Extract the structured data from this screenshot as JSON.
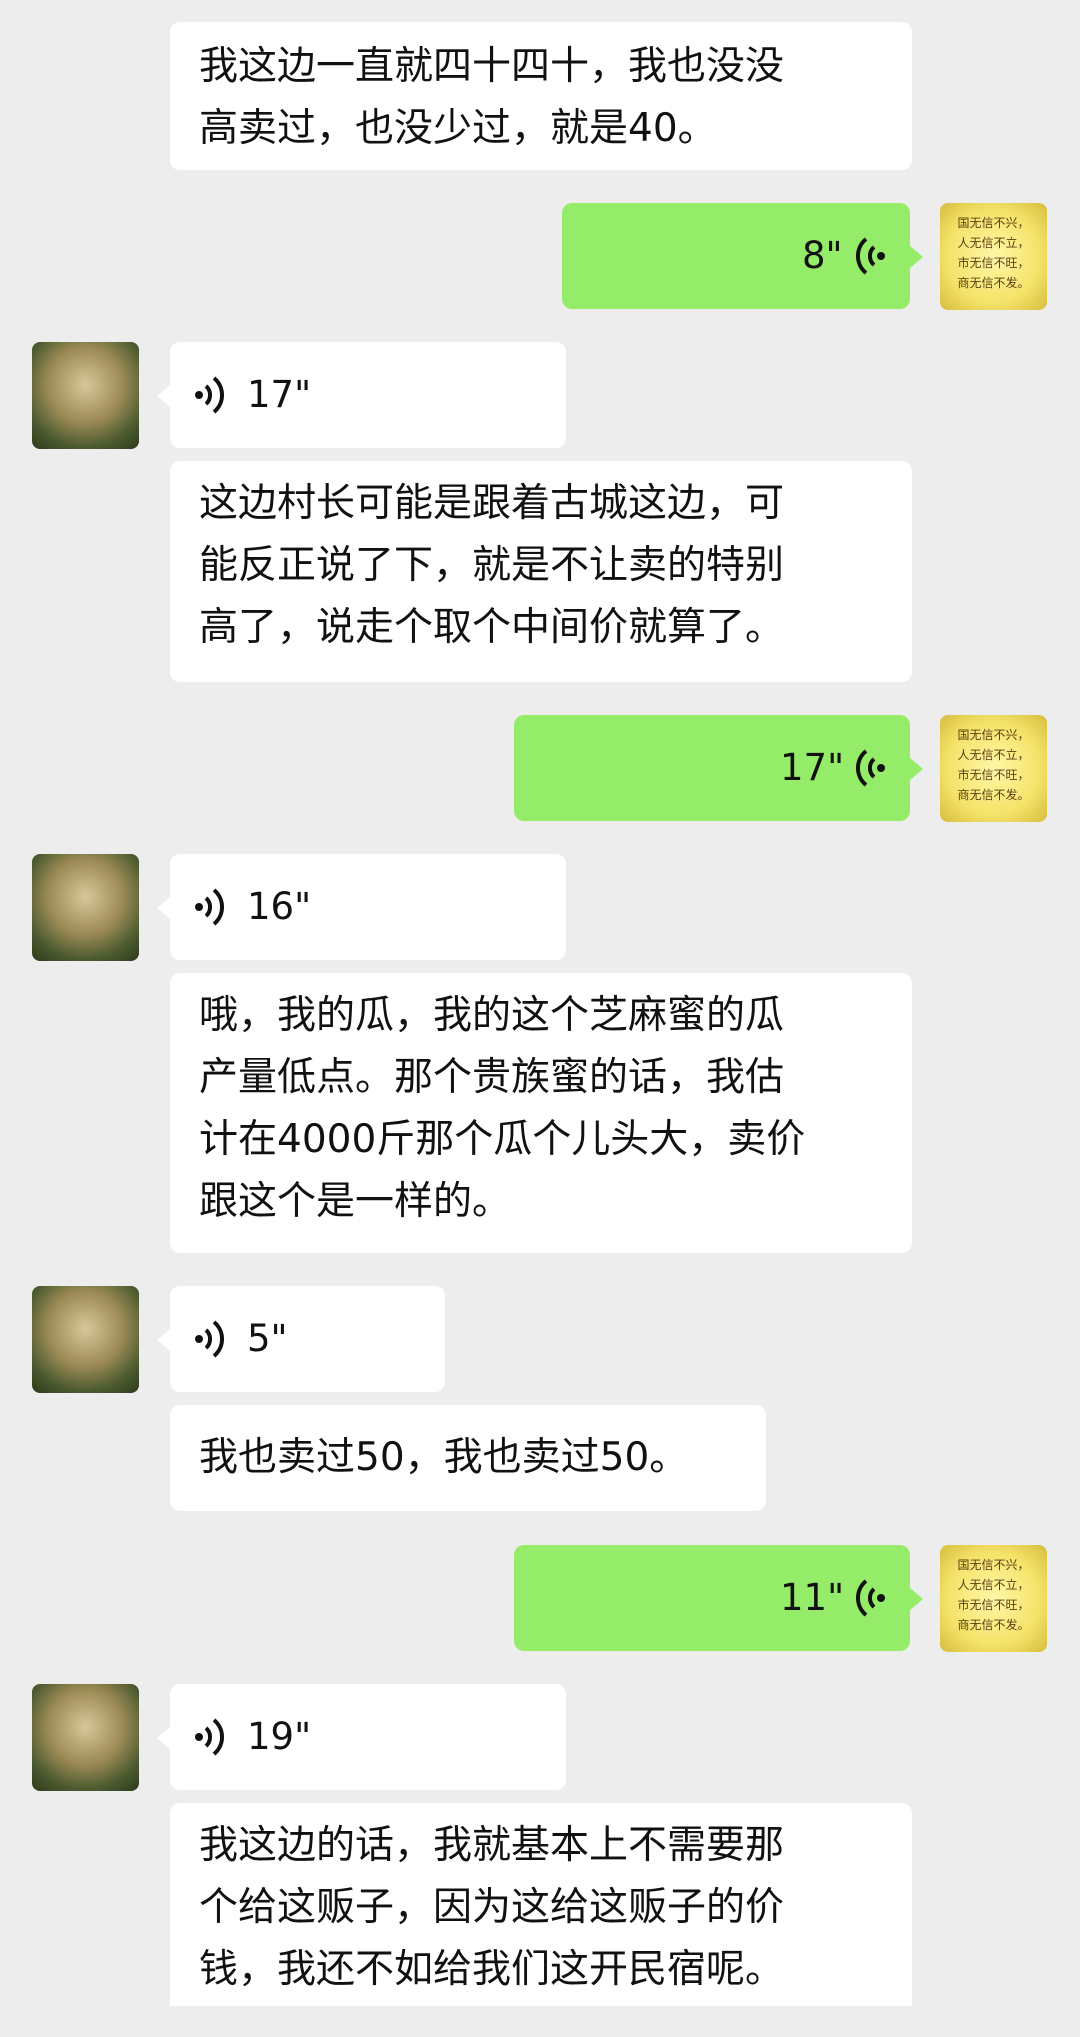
{
  "messages": [
    {
      "side": "in",
      "type": "text",
      "lines": [
        "我这边一直就四十四十，我也没没",
        "高卖过，也没少过，就是40。"
      ]
    },
    {
      "side": "out",
      "type": "voice",
      "duration": "8\""
    },
    {
      "side": "in",
      "type": "voice",
      "duration": "17\""
    },
    {
      "side": "in",
      "type": "text",
      "lines": [
        "这边村长可能是跟着古城这边，可",
        "能反正说了下，就是不让卖的特别",
        "高了，说走个取个中间价就算了。"
      ]
    },
    {
      "side": "out",
      "type": "voice",
      "duration": "17\""
    },
    {
      "side": "in",
      "type": "voice",
      "duration": "16\""
    },
    {
      "side": "in",
      "type": "text",
      "lines": [
        "哦，我的瓜，我的这个芝麻蜜的瓜",
        "产量低点。那个贵族蜜的话，我估",
        "计在4000斤那个瓜个儿头大，卖价",
        "跟这个是一样的。"
      ]
    },
    {
      "side": "in",
      "type": "voice",
      "duration": "5\""
    },
    {
      "side": "in",
      "type": "text",
      "lines": [
        "我也卖过50，我也卖过50。"
      ]
    },
    {
      "side": "out",
      "type": "voice",
      "duration": "11\""
    },
    {
      "side": "in",
      "type": "voice",
      "duration": "19\""
    },
    {
      "side": "in",
      "type": "text",
      "lines": [
        "我这边的话，我就基本上不需要那",
        "个给这贩子，因为这给这贩子的价",
        "钱，我还不如给我们这开民宿呢。"
      ]
    }
  ],
  "my_avatar_lines": [
    "国无信不兴，",
    "人无信不立，",
    "市无信不旺，",
    "商无信不发。"
  ]
}
